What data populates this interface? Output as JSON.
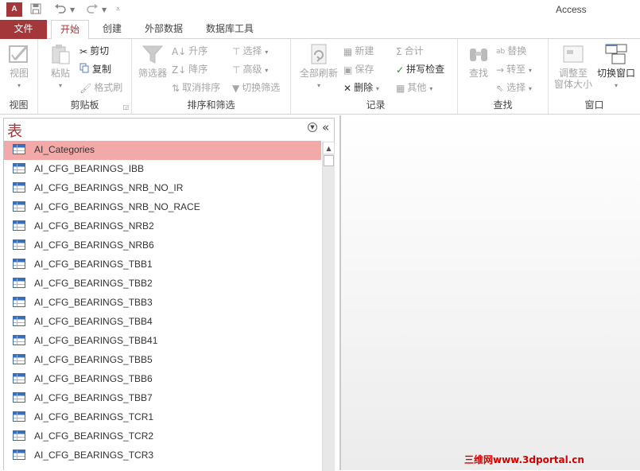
{
  "app": {
    "title": "Access",
    "icon_label": "A"
  },
  "quick_access": {
    "icons": [
      "save-icon",
      "undo-icon",
      "redo-icon",
      "customize-icon"
    ]
  },
  "tabs": [
    {
      "label": "文件"
    },
    {
      "label": "开始"
    },
    {
      "label": "创建"
    },
    {
      "label": "外部数据"
    },
    {
      "label": "数据库工具"
    }
  ],
  "ribbon": {
    "views": {
      "view": "视图",
      "group": "视图"
    },
    "clipboard": {
      "paste": "粘贴",
      "cut": "剪切",
      "copy": "复制",
      "format_painter": "格式刷",
      "group": "剪贴板"
    },
    "sort_filter": {
      "filter": "筛选器",
      "ascending": "升序",
      "descending": "降序",
      "remove_sort": "取消排序",
      "selection": "选择",
      "advanced": "高级",
      "toggle_filter": "切换筛选",
      "group": "排序和筛选"
    },
    "records": {
      "refresh_all": "全部刷新",
      "new": "新建",
      "save": "保存",
      "delete": "删除",
      "totals": "合计",
      "spelling": "拼写检查",
      "more": "其他",
      "group": "记录"
    },
    "find": {
      "find": "查找",
      "replace": "替换",
      "goto": "转至",
      "select": "选择",
      "group": "查找"
    },
    "window": {
      "size_to_fit_1": "调整至",
      "size_to_fit_2": "窗体大小",
      "switch": "切换窗口",
      "group": "窗口"
    }
  },
  "nav_pane": {
    "title": "表",
    "items": [
      "AI_Categories",
      "AI_CFG_BEARINGS_IBB",
      "AI_CFG_BEARINGS_NRB_NO_IR",
      "AI_CFG_BEARINGS_NRB_NO_RACE",
      "AI_CFG_BEARINGS_NRB2",
      "AI_CFG_BEARINGS_NRB6",
      "AI_CFG_BEARINGS_TBB1",
      "AI_CFG_BEARINGS_TBB2",
      "AI_CFG_BEARINGS_TBB3",
      "AI_CFG_BEARINGS_TBB4",
      "AI_CFG_BEARINGS_TBB41",
      "AI_CFG_BEARINGS_TBB5",
      "AI_CFG_BEARINGS_TBB6",
      "AI_CFG_BEARINGS_TBB7",
      "AI_CFG_BEARINGS_TCR1",
      "AI_CFG_BEARINGS_TCR2",
      "AI_CFG_BEARINGS_TCR3"
    ],
    "selected_index": 0
  },
  "watermark": "三维网www.3dportal.cn",
  "colors": {
    "accent": "#a4373a",
    "selected_row": "#f4a9a9",
    "watermark": "#d40000"
  }
}
